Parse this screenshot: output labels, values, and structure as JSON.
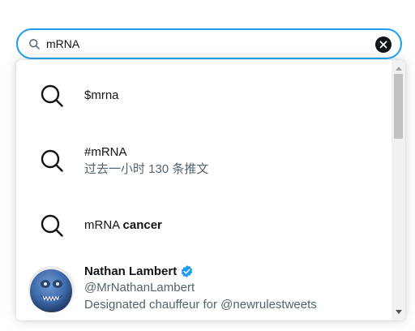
{
  "search": {
    "value": "mRNA",
    "clear_icon": "close-icon"
  },
  "suggestions": [
    {
      "type": "query",
      "icon": "search-icon",
      "label": "$mrna"
    },
    {
      "type": "query",
      "icon": "search-icon",
      "label": "#mRNA",
      "sub": "过去一小时 130 条推文"
    },
    {
      "type": "query",
      "icon": "search-icon",
      "prefix": "mRNA ",
      "bold": "cancer"
    }
  ],
  "user": {
    "name": "Nathan Lambert",
    "handle": "@MrNathanLambert",
    "bio": "Designated chauffeur for @newrulestweets",
    "verified_icon": "verified-badge-icon"
  },
  "colors": {
    "accent": "#1d9bf0",
    "text": "#0f1419",
    "secondary": "#536471"
  }
}
